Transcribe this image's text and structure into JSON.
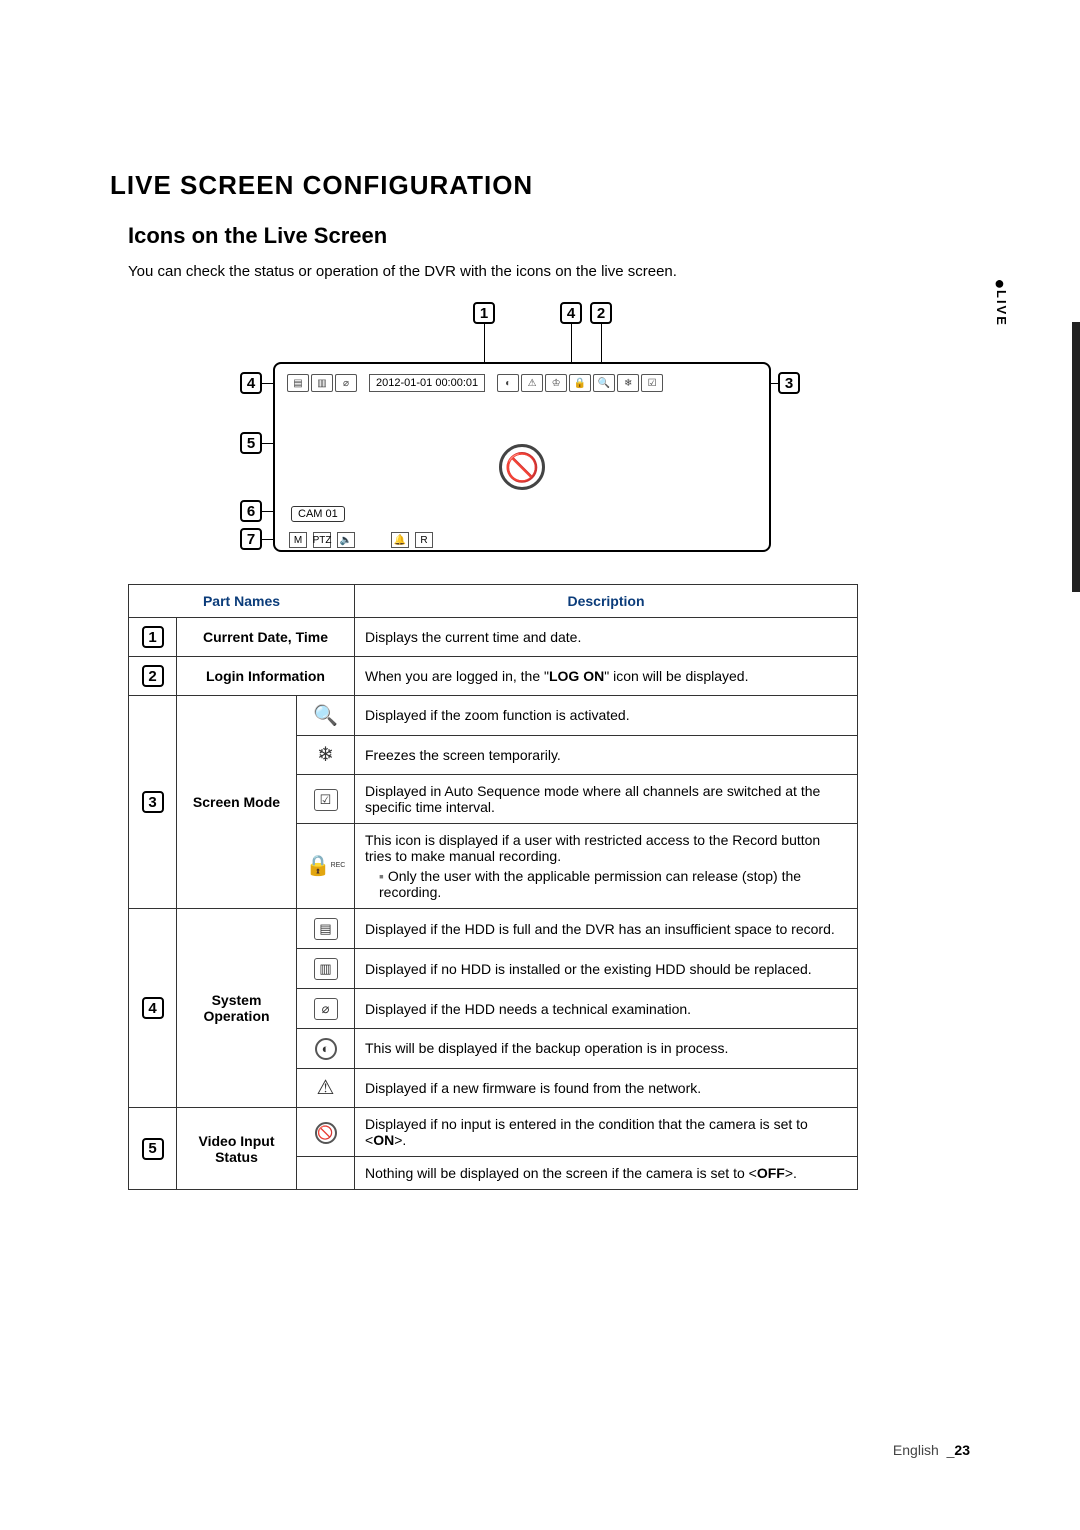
{
  "section_title": "LIVE SCREEN CONFIGURATION",
  "subsection_title": "Icons on the Live Screen",
  "intro_text": "You can check the status or operation of the DVR with the icons on the live screen.",
  "side_tab_label": "LIVE",
  "diagram": {
    "datetime": "2012-01-01  00:00:01",
    "cam_label": "CAM 01",
    "callouts": {
      "c1": "1",
      "c2": "2",
      "c3": "3",
      "c4t": "4",
      "c4l": "4",
      "c5": "5",
      "c6": "6",
      "c7": "7"
    }
  },
  "table": {
    "headers": {
      "parts": "Part Names",
      "desc": "Description"
    },
    "rows": [
      {
        "num": "1",
        "part": "Current Date, Time",
        "entries": [
          {
            "icon": "",
            "desc_html": "Displays the current time and date."
          }
        ]
      },
      {
        "num": "2",
        "part": "Login Information",
        "entries": [
          {
            "icon": "",
            "desc_html": "When you are logged in, the \"<b>LOG ON</b>\" icon will be displayed."
          }
        ]
      },
      {
        "num": "3",
        "part": "Screen Mode",
        "entries": [
          {
            "icon": "zoom",
            "desc_html": "Displayed if the zoom function is activated."
          },
          {
            "icon": "freeze",
            "desc_html": "Freezes the screen temporarily."
          },
          {
            "icon": "autoseq",
            "desc_html": "Displayed in Auto Sequence mode where all channels are switched at the specific time interval."
          },
          {
            "icon": "reclock",
            "desc_html": "This icon is displayed if a user with restricted access to the Record button tries to make manual recording.<ul class='note'><li>Only the user with the applicable permission can release (stop) the recording.</li></ul>"
          }
        ]
      },
      {
        "num": "4",
        "part": "System Operation",
        "entries": [
          {
            "icon": "hddfull",
            "desc_html": "Displayed if the HDD is full and the DVR has an insufficient space to record."
          },
          {
            "icon": "nohdd",
            "desc_html": "Displayed if no HDD is installed or the existing HDD should be replaced."
          },
          {
            "icon": "hddexam",
            "desc_html": "Displayed if the HDD needs a technical examination."
          },
          {
            "icon": "backup",
            "desc_html": "This will be displayed if the backup operation is in process."
          },
          {
            "icon": "fw",
            "desc_html": "Displayed if a new firmware is found from the network."
          }
        ]
      },
      {
        "num": "5",
        "part": "Video Input Status",
        "entries": [
          {
            "icon": "nosignal",
            "desc_html": "Displayed if no input is entered in the condition that the camera is set to &lt;<b>ON</b>&gt;."
          },
          {
            "icon": "",
            "desc_html": "Nothing will be displayed on the screen if the camera is set to &lt;<b>OFF</b>&gt;."
          }
        ]
      }
    ]
  },
  "footer": {
    "lang": "English",
    "sep": "_",
    "pnum": "23"
  }
}
